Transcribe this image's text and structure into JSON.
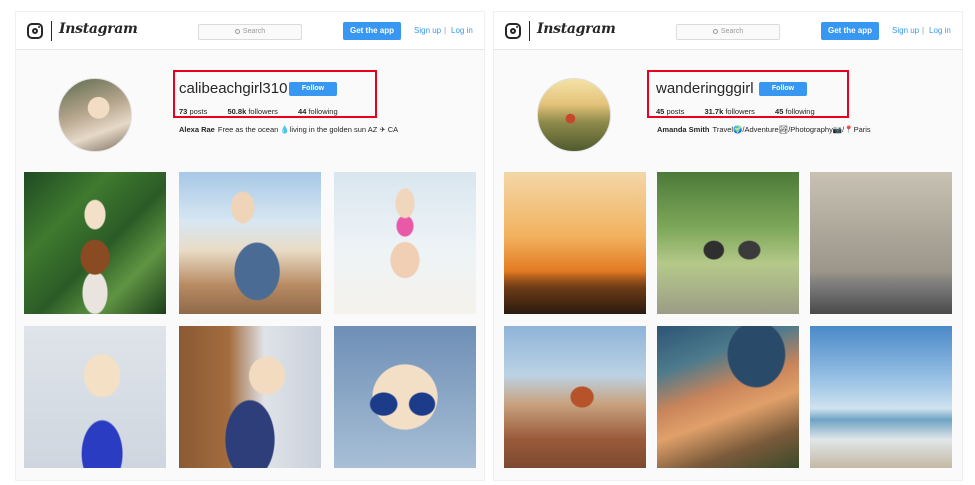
{
  "panels": [
    {
      "header": {
        "wordmark": "Instagram",
        "search_placeholder": "Search",
        "get_app_label": "Get the app",
        "sign_up_label": "Sign up",
        "separator": "|",
        "log_in_label": "Log in"
      },
      "profile": {
        "username": "calibeachgirl310",
        "follow_label": "Follow",
        "posts_count": "73",
        "posts_label": "posts",
        "followers_count": "50.8k",
        "followers_label": "followers",
        "following_count": "44",
        "following_label": "following",
        "name": "Alexa Rae",
        "bio": "Free as the ocean 💧living in the golden sun AZ ✈ CA"
      }
    },
    {
      "header": {
        "wordmark": "Instagram",
        "search_placeholder": "Search",
        "get_app_label": "Get the app",
        "sign_up_label": "Sign up",
        "separator": "|",
        "log_in_label": "Log in"
      },
      "profile": {
        "username": "wanderingggirl",
        "follow_label": "Follow",
        "posts_count": "45",
        "posts_label": "posts",
        "followers_count": "31.7k",
        "followers_label": "followers",
        "following_count": "45",
        "following_label": "following",
        "name": "Amanda Smith",
        "bio": "Travel🌍/Adventure🏞/Photography📷/📍Paris"
      }
    }
  ],
  "colors": {
    "accent": "#3897f0",
    "highlight_box": "#e8001c"
  }
}
